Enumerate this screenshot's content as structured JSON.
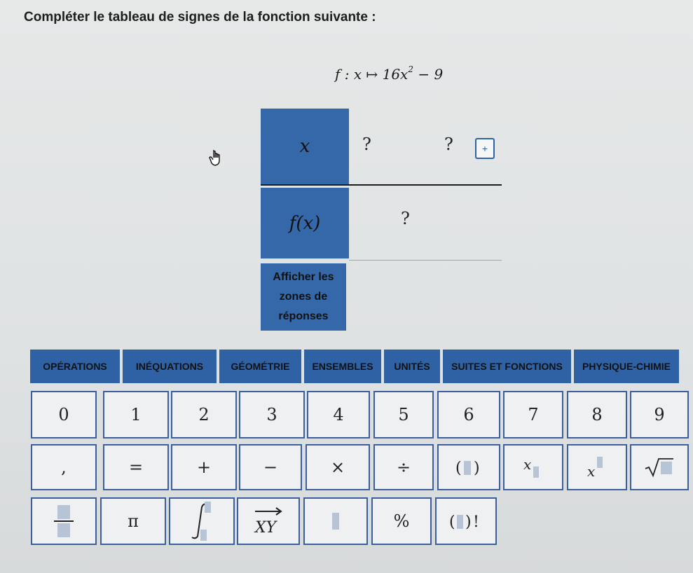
{
  "instruction": "Compléter le tableau de signes de la fonction suivante :",
  "formula": {
    "prefix": "f : x ↦ 16x",
    "exponent": "2",
    "suffix": " − 9"
  },
  "table": {
    "x_label": "x",
    "fx_label": "f(x)",
    "x_row_values": [
      "?",
      "?"
    ],
    "fx_row_value": "?",
    "add_button": "+"
  },
  "show_answers": [
    "Afficher les",
    "zones de",
    "réponses"
  ],
  "tabs": [
    "OPÉRATIONS",
    "INÉQUATIONS",
    "GÉOMÉTRIE",
    "ENSEMBLES",
    "UNITÉS",
    "SUITES ET FONCTIONS",
    "PHYSIQUE-CHIMIE"
  ],
  "keypad": {
    "row1": [
      "0",
      "1",
      "2",
      "3",
      "4",
      "5",
      "6",
      "7",
      "8",
      "9"
    ],
    "row2": [
      ",",
      "=",
      "+",
      "−",
      "×",
      "÷"
    ],
    "row3": [
      "π",
      "%"
    ],
    "icons": {
      "parentheses": "parentheses-icon",
      "subscript": "subscript-icon",
      "superscript": "superscript-icon",
      "sqrt": "sqrt-icon",
      "fraction": "fraction-icon",
      "integral": "integral-icon",
      "vector": "vector-icon",
      "box": "box-icon",
      "factorial": "factorial-icon"
    },
    "vector_label": "XY",
    "factorial_label": "!"
  },
  "colors": {
    "accent": "#2f62a5",
    "table_header": "#3568a8"
  }
}
